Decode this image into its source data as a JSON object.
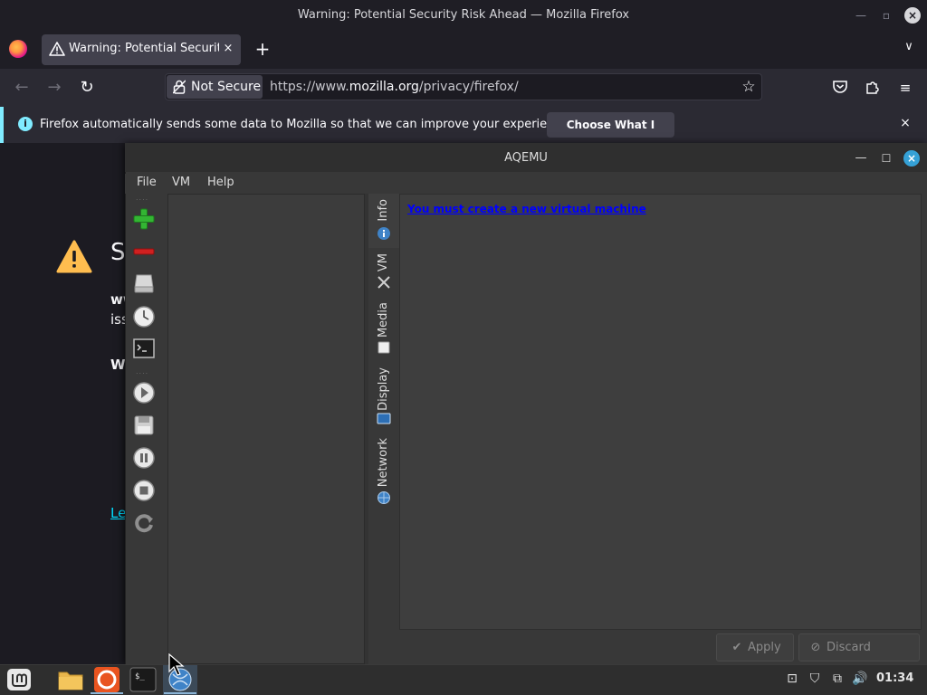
{
  "firefox": {
    "window_title": "Warning: Potential Security Risk Ahead — Mozilla Firefox",
    "tab": {
      "label": "Warning: Potential Security Risk Ahead",
      "close": "×"
    },
    "new_tab": "+",
    "url": {
      "security_label": "Not Secure",
      "prefix": "https://www.",
      "host": "mozilla.org",
      "path": "/privacy/firefox/"
    },
    "infobar": {
      "message": "Firefox automatically sends some data to Mozilla so that we can improve your experience.",
      "button": "Choose What I Share",
      "close": "×"
    },
    "page": {
      "heading_partial": "Se",
      "text1_partial": "ww",
      "text2_partial": "iss",
      "text3_partial": "Wh",
      "link_partial": "Le"
    }
  },
  "aqemu": {
    "title": "AQEMU",
    "menus": [
      "File",
      "VM",
      "Help"
    ],
    "tabs": [
      {
        "label": "Info"
      },
      {
        "label": "VM"
      },
      {
        "label": "Media"
      },
      {
        "label": "Display"
      },
      {
        "label": "Network"
      }
    ],
    "message": "You must create a new virtual machine",
    "buttons": {
      "apply": "Apply",
      "discard": "Discard Changes"
    }
  },
  "taskbar": {
    "clock": "01:34"
  },
  "colors": {
    "accent": "#35a1d6",
    "infobar_accent": "#80ebff",
    "link": "#00ddff",
    "message": "#0000ff"
  }
}
